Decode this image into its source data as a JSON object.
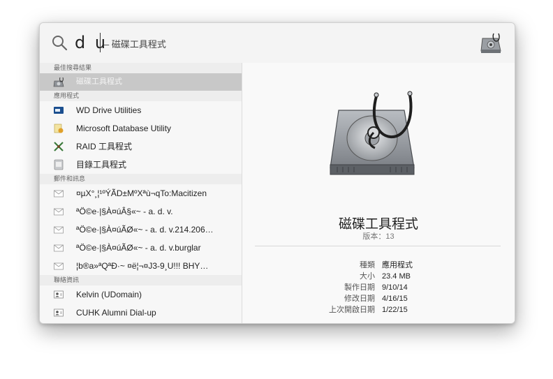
{
  "search": {
    "query": "d u",
    "suggestion": "– 磁碟工具程式"
  },
  "sections": {
    "top_hit": "最佳搜尋結果",
    "applications": "應用程式",
    "mail": "郵件和訊息",
    "contacts": "聯絡資訊"
  },
  "results": {
    "top_hit": "磁碟工具程式",
    "apps": [
      {
        "label": "WD Drive Utilities",
        "icon": "drive-icon"
      },
      {
        "label": "Microsoft Database Utility",
        "icon": "database-icon"
      },
      {
        "label": "RAID 工具程式",
        "icon": "raid-icon"
      },
      {
        "label": "目錄工具程式",
        "icon": "directory-icon"
      }
    ],
    "mail": [
      {
        "label": "¤µX°¸¦¹ºÝÃD±MºXªù¬qTo:Macitizen"
      },
      {
        "label": "ªÖ©e·|§À¤úÂ§«~ - a. d. v."
      },
      {
        "label": "ªÖ©e·|§À¤úÃØ«~ - a. d. v.214.206…"
      },
      {
        "label": "ªÖ©e·|§À¤úÃØ«~ - a. d. v.burglar"
      },
      {
        "label": "¦b®a»ªQªÐ·~ ¤ë¦¬¤J3-9¸U!!! BHY…"
      }
    ],
    "contacts": [
      {
        "label": "Kelvin (UDomain)"
      },
      {
        "label": "CUHK Alumni Dial-up"
      }
    ]
  },
  "preview": {
    "title": "磁碟工具程式",
    "version": "版本：13",
    "details": [
      {
        "key": "種類",
        "value": "應用程式"
      },
      {
        "key": "大小",
        "value": "23.4 MB"
      },
      {
        "key": "製作日期",
        "value": "9/10/14"
      },
      {
        "key": "修改日期",
        "value": "4/16/15"
      },
      {
        "key": "上次開啟日期",
        "value": "1/22/15"
      }
    ]
  }
}
